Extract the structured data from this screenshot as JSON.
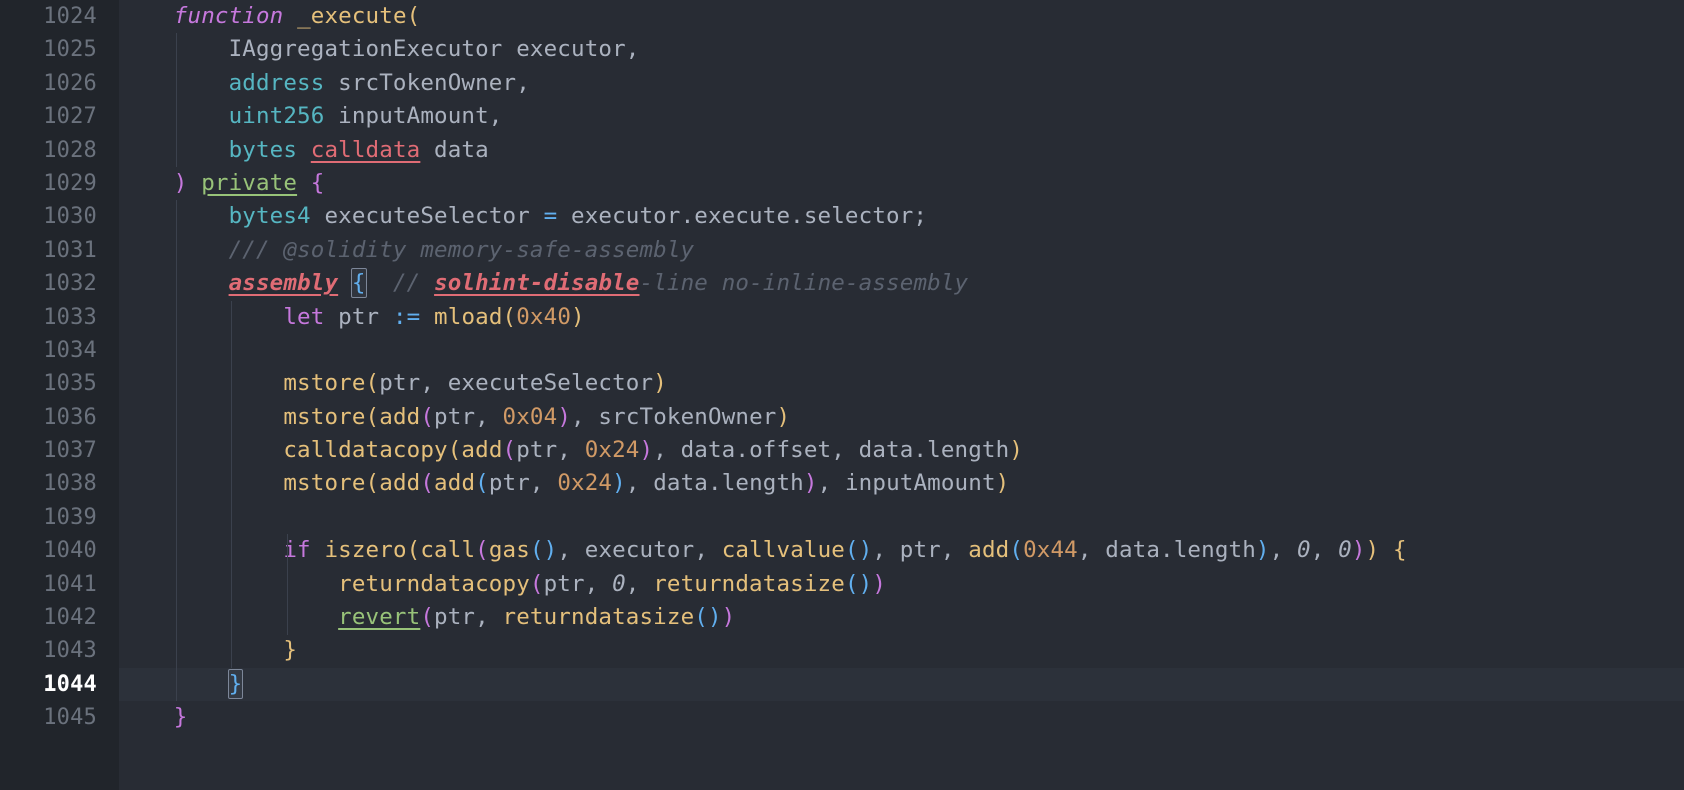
{
  "editor": {
    "theme_name": "one-dark",
    "language": "solidity",
    "colors": {
      "gutter_background": "#21252b",
      "code_background": "#282c34",
      "active_line_background": "#2c313a",
      "line_number": "#6b727d",
      "active_line_number": "#ffffff",
      "default_text": "#abb2bf",
      "keyword": "#c678dd",
      "type": "#56b6c2",
      "function": "#e5c07b",
      "number": "#d19a66",
      "operator": "#61afef",
      "comment": "#5c6370",
      "error_underline": "#e06c75",
      "string_green": "#98c379",
      "bracket_1": "#e5c07b",
      "bracket_2": "#c678dd",
      "bracket_3": "#61afef"
    },
    "active_line_number": 1044,
    "first_line_number": 1024,
    "last_line_number": 1045
  },
  "lines": [
    {
      "number": "1024",
      "active": false,
      "tokens": [
        {
          "text": "    ",
          "cls": "t-ident"
        },
        {
          "text": "function",
          "cls": "t-kw"
        },
        {
          "text": " ",
          "cls": "t-ident"
        },
        {
          "text": "_execute",
          "cls": "t-fn"
        },
        {
          "text": "(",
          "cls": "b1"
        }
      ]
    },
    {
      "number": "1025",
      "active": false,
      "tokens": [
        {
          "text": "        ",
          "cls": "t-ident"
        },
        {
          "text": "IAggregationExecutor",
          "cls": "t-ident"
        },
        {
          "text": " executor,",
          "cls": "t-ident"
        }
      ]
    },
    {
      "number": "1026",
      "active": false,
      "tokens": [
        {
          "text": "        ",
          "cls": "t-ident"
        },
        {
          "text": "address",
          "cls": "t-type"
        },
        {
          "text": " srcTokenOwner,",
          "cls": "t-ident"
        }
      ]
    },
    {
      "number": "1027",
      "active": false,
      "tokens": [
        {
          "text": "        ",
          "cls": "t-ident"
        },
        {
          "text": "uint256",
          "cls": "t-type"
        },
        {
          "text": " inputAmount,",
          "cls": "t-ident"
        }
      ]
    },
    {
      "number": "1028",
      "active": false,
      "tokens": [
        {
          "text": "        ",
          "cls": "t-ident"
        },
        {
          "text": "bytes",
          "cls": "t-type"
        },
        {
          "text": " ",
          "cls": "t-ident"
        },
        {
          "text": "calldata",
          "cls": "t-err"
        },
        {
          "text": " data",
          "cls": "t-ident"
        }
      ]
    },
    {
      "number": "1029",
      "active": false,
      "tokens": [
        {
          "text": "    ",
          "cls": "t-ident"
        },
        {
          "text": ")",
          "cls": "b2"
        },
        {
          "text": " ",
          "cls": "t-ident"
        },
        {
          "text": "private",
          "cls": "t-green-u"
        },
        {
          "text": " ",
          "cls": "t-ident"
        },
        {
          "text": "{",
          "cls": "b2"
        }
      ]
    },
    {
      "number": "1030",
      "active": false,
      "tokens": [
        {
          "text": "        ",
          "cls": "t-ident"
        },
        {
          "text": "bytes4",
          "cls": "t-type"
        },
        {
          "text": " executeSelector ",
          "cls": "t-ident"
        },
        {
          "text": "=",
          "cls": "t-op"
        },
        {
          "text": " executor.execute.selector;",
          "cls": "t-ident"
        }
      ]
    },
    {
      "number": "1031",
      "active": false,
      "tokens": [
        {
          "text": "        ",
          "cls": "t-ident"
        },
        {
          "text": "/// @solidity memory-safe-assembly",
          "cls": "t-comment"
        }
      ]
    },
    {
      "number": "1032",
      "active": false,
      "tokens": [
        {
          "text": "        ",
          "cls": "t-ident"
        },
        {
          "text": "assembly",
          "cls": "t-err-b"
        },
        {
          "text": " ",
          "cls": "t-ident"
        },
        {
          "text": "{",
          "cls": "b3",
          "match": true
        },
        {
          "text": "  ",
          "cls": "t-ident"
        },
        {
          "text": "// ",
          "cls": "t-comment"
        },
        {
          "text": "solhint-disable",
          "cls": "t-err-b"
        },
        {
          "text": "-line no-inline-assembly",
          "cls": "t-comment"
        }
      ]
    },
    {
      "number": "1033",
      "active": false,
      "tokens": [
        {
          "text": "            ",
          "cls": "t-ident"
        },
        {
          "text": "let",
          "cls": "t-kw2"
        },
        {
          "text": " ptr ",
          "cls": "t-ident"
        },
        {
          "text": ":=",
          "cls": "t-op"
        },
        {
          "text": " ",
          "cls": "t-ident"
        },
        {
          "text": "mload",
          "cls": "t-fn"
        },
        {
          "text": "(",
          "cls": "b1"
        },
        {
          "text": "0x40",
          "cls": "t-num"
        },
        {
          "text": ")",
          "cls": "b1"
        }
      ]
    },
    {
      "number": "1034",
      "active": false,
      "tokens": []
    },
    {
      "number": "1035",
      "active": false,
      "tokens": [
        {
          "text": "            ",
          "cls": "t-ident"
        },
        {
          "text": "mstore",
          "cls": "t-fn"
        },
        {
          "text": "(",
          "cls": "b1"
        },
        {
          "text": "ptr, executeSelector",
          "cls": "t-ident"
        },
        {
          "text": ")",
          "cls": "b1"
        }
      ]
    },
    {
      "number": "1036",
      "active": false,
      "tokens": [
        {
          "text": "            ",
          "cls": "t-ident"
        },
        {
          "text": "mstore",
          "cls": "t-fn"
        },
        {
          "text": "(",
          "cls": "b1"
        },
        {
          "text": "add",
          "cls": "t-fn"
        },
        {
          "text": "(",
          "cls": "b2"
        },
        {
          "text": "ptr, ",
          "cls": "t-ident"
        },
        {
          "text": "0x04",
          "cls": "t-num"
        },
        {
          "text": ")",
          "cls": "b2"
        },
        {
          "text": ", srcTokenOwner",
          "cls": "t-ident"
        },
        {
          "text": ")",
          "cls": "b1"
        }
      ]
    },
    {
      "number": "1037",
      "active": false,
      "tokens": [
        {
          "text": "            ",
          "cls": "t-ident"
        },
        {
          "text": "calldatacopy",
          "cls": "t-fn"
        },
        {
          "text": "(",
          "cls": "b1"
        },
        {
          "text": "add",
          "cls": "t-fn"
        },
        {
          "text": "(",
          "cls": "b2"
        },
        {
          "text": "ptr, ",
          "cls": "t-ident"
        },
        {
          "text": "0x24",
          "cls": "t-num"
        },
        {
          "text": ")",
          "cls": "b2"
        },
        {
          "text": ", data.offset, data.length",
          "cls": "t-ident"
        },
        {
          "text": ")",
          "cls": "b1"
        }
      ]
    },
    {
      "number": "1038",
      "active": false,
      "tokens": [
        {
          "text": "            ",
          "cls": "t-ident"
        },
        {
          "text": "mstore",
          "cls": "t-fn"
        },
        {
          "text": "(",
          "cls": "b1"
        },
        {
          "text": "add",
          "cls": "t-fn"
        },
        {
          "text": "(",
          "cls": "b2"
        },
        {
          "text": "add",
          "cls": "t-fn"
        },
        {
          "text": "(",
          "cls": "b3"
        },
        {
          "text": "ptr, ",
          "cls": "t-ident"
        },
        {
          "text": "0x24",
          "cls": "t-num"
        },
        {
          "text": ")",
          "cls": "b3"
        },
        {
          "text": ", data.length",
          "cls": "t-ident"
        },
        {
          "text": ")",
          "cls": "b2"
        },
        {
          "text": ", inputAmount",
          "cls": "t-ident"
        },
        {
          "text": ")",
          "cls": "b1"
        }
      ]
    },
    {
      "number": "1039",
      "active": false,
      "tokens": []
    },
    {
      "number": "1040",
      "active": false,
      "tokens": [
        {
          "text": "            ",
          "cls": "t-ident"
        },
        {
          "text": "if",
          "cls": "t-kw2"
        },
        {
          "text": " ",
          "cls": "t-ident"
        },
        {
          "text": "iszero",
          "cls": "t-fn"
        },
        {
          "text": "(",
          "cls": "b1"
        },
        {
          "text": "call",
          "cls": "t-fn"
        },
        {
          "text": "(",
          "cls": "b2"
        },
        {
          "text": "gas",
          "cls": "t-fn"
        },
        {
          "text": "(",
          "cls": "b3"
        },
        {
          "text": ")",
          "cls": "b3"
        },
        {
          "text": ", executor, ",
          "cls": "t-ident"
        },
        {
          "text": "callvalue",
          "cls": "t-fn"
        },
        {
          "text": "(",
          "cls": "b3"
        },
        {
          "text": ")",
          "cls": "b3"
        },
        {
          "text": ", ptr, ",
          "cls": "t-ident"
        },
        {
          "text": "add",
          "cls": "t-fn"
        },
        {
          "text": "(",
          "cls": "b3"
        },
        {
          "text": "0x44",
          "cls": "t-num"
        },
        {
          "text": ", data.length",
          "cls": "t-ident"
        },
        {
          "text": ")",
          "cls": "b3"
        },
        {
          "text": ", ",
          "cls": "t-ident"
        },
        {
          "text": "0",
          "cls": "t-num2"
        },
        {
          "text": ", ",
          "cls": "t-ident"
        },
        {
          "text": "0",
          "cls": "t-num2"
        },
        {
          "text": ")",
          "cls": "b2"
        },
        {
          "text": ")",
          "cls": "b1"
        },
        {
          "text": " ",
          "cls": "t-ident"
        },
        {
          "text": "{",
          "cls": "b1"
        }
      ]
    },
    {
      "number": "1041",
      "active": false,
      "tokens": [
        {
          "text": "                ",
          "cls": "t-ident"
        },
        {
          "text": "returndatacopy",
          "cls": "t-fn"
        },
        {
          "text": "(",
          "cls": "b2"
        },
        {
          "text": "ptr, ",
          "cls": "t-ident"
        },
        {
          "text": "0",
          "cls": "t-num2"
        },
        {
          "text": ", ",
          "cls": "t-ident"
        },
        {
          "text": "returndatasize",
          "cls": "t-fn"
        },
        {
          "text": "(",
          "cls": "b3"
        },
        {
          "text": ")",
          "cls": "b3"
        },
        {
          "text": ")",
          "cls": "b2"
        }
      ]
    },
    {
      "number": "1042",
      "active": false,
      "tokens": [
        {
          "text": "                ",
          "cls": "t-ident"
        },
        {
          "text": "revert",
          "cls": "t-green-u"
        },
        {
          "text": "(",
          "cls": "b2"
        },
        {
          "text": "ptr, ",
          "cls": "t-ident"
        },
        {
          "text": "returndatasize",
          "cls": "t-fn"
        },
        {
          "text": "(",
          "cls": "b3"
        },
        {
          "text": ")",
          "cls": "b3"
        },
        {
          "text": ")",
          "cls": "b2"
        }
      ]
    },
    {
      "number": "1043",
      "active": false,
      "tokens": [
        {
          "text": "            ",
          "cls": "t-ident"
        },
        {
          "text": "}",
          "cls": "b1"
        }
      ]
    },
    {
      "number": "1044",
      "active": true,
      "tokens": [
        {
          "text": "        ",
          "cls": "t-ident"
        },
        {
          "text": "}",
          "cls": "b3",
          "match": true
        }
      ]
    },
    {
      "number": "1045",
      "active": false,
      "tokens": [
        {
          "text": "    ",
          "cls": "t-ident"
        },
        {
          "text": "}",
          "cls": "b2"
        }
      ]
    }
  ],
  "code_text": "    function _execute(\n        IAggregationExecutor executor,\n        address srcTokenOwner,\n        uint256 inputAmount,\n        bytes calldata data\n    ) private {\n        bytes4 executeSelector = executor.execute.selector;\n        /// @solidity memory-safe-assembly\n        assembly {  // solhint-disable-line no-inline-assembly\n            let ptr := mload(0x40)\n\n            mstore(ptr, executeSelector)\n            mstore(add(ptr, 0x04), srcTokenOwner)\n            calldatacopy(add(ptr, 0x24), data.offset, data.length)\n            mstore(add(add(ptr, 0x24), data.length), inputAmount)\n\n            if iszero(call(gas(), executor, callvalue(), ptr, add(0x44, data.length), 0, 0)) {\n                returndatacopy(ptr, 0, returndatasize())\n                revert(ptr, returndatasize())\n            }\n        }\n    }"
}
